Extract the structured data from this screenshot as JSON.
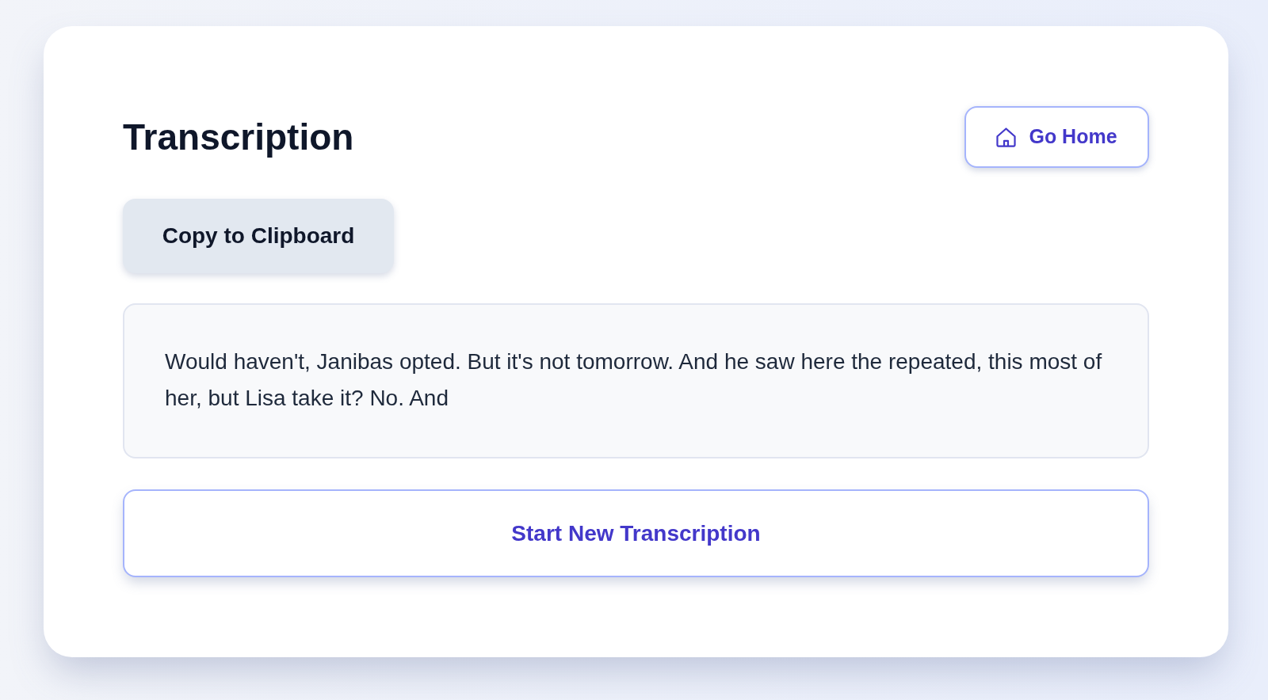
{
  "header": {
    "title": "Transcription",
    "home_button": {
      "label": "Go Home"
    }
  },
  "copy_button": {
    "label": "Copy to Clipboard"
  },
  "transcript": {
    "text": "Would haven't, Janibas opted. But it's not tomorrow. And he saw here the repeated, this most of her, but Lisa take it? No. And"
  },
  "new_button": {
    "label": "Start New Transcription"
  }
}
